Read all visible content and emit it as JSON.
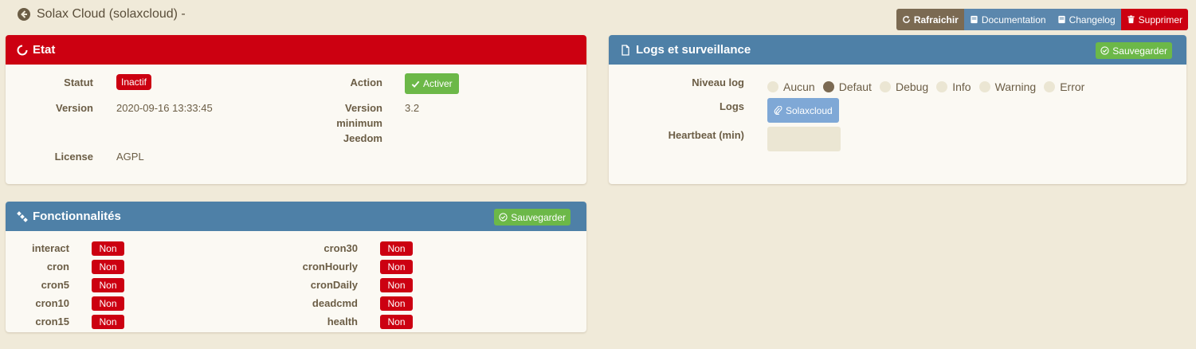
{
  "header": {
    "title": "Solax Cloud (solaxcloud) -",
    "actions": {
      "refresh": "Rafraichir",
      "documentation": "Documentation",
      "changelog": "Changelog",
      "delete": "Supprimer"
    }
  },
  "etat": {
    "title": "Etat",
    "statut_label": "Statut",
    "statut_value": "Inactif",
    "action_label": "Action",
    "action_button": "Activer",
    "version_label": "Version",
    "version_value": "2020-09-16 13:33:45",
    "min_version_label_1": "Version",
    "min_version_label_2": "minimum",
    "min_version_label_3": "Jeedom",
    "min_version_value": "3.2",
    "license_label": "License",
    "license_value": "AGPL"
  },
  "logs": {
    "title": "Logs et surveillance",
    "save_label": "Sauvegarder",
    "level_label": "Niveau log",
    "levels": [
      "Aucun",
      "Defaut",
      "Debug",
      "Info",
      "Warning",
      "Error"
    ],
    "selected_level": "Defaut",
    "logs_label": "Logs",
    "log_button": "Solaxcloud",
    "heartbeat_label": "Heartbeat (min)",
    "heartbeat_value": ""
  },
  "features": {
    "title": "Fonctionnalités",
    "save_label": "Sauvegarder",
    "left": [
      {
        "name": "interact",
        "value": "Non"
      },
      {
        "name": "cron",
        "value": "Non"
      },
      {
        "name": "cron5",
        "value": "Non"
      },
      {
        "name": "cron10",
        "value": "Non"
      },
      {
        "name": "cron15",
        "value": "Non"
      }
    ],
    "right": [
      {
        "name": "cron30",
        "value": "Non"
      },
      {
        "name": "cronHourly",
        "value": "Non"
      },
      {
        "name": "cronDaily",
        "value": "Non"
      },
      {
        "name": "deadcmd",
        "value": "Non"
      },
      {
        "name": "health",
        "value": "Non"
      }
    ]
  },
  "colors": {
    "background": "#f0ead9",
    "danger": "#cc0011",
    "primary": "#4e80a7",
    "success": "#6cb848",
    "warning": "#7b6a52"
  }
}
